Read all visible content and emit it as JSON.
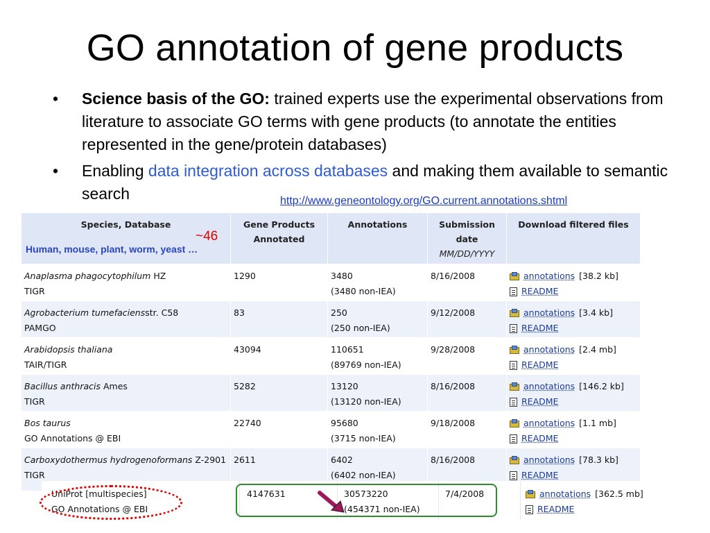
{
  "slide": {
    "title": "GO annotation of gene products",
    "bullets": [
      {
        "bold": "Science basis of the GO:",
        "text": " trained experts use the experimental observations from literature to associate GO terms with gene products (to annotate the entities represented in the gene/protein databases)"
      },
      {
        "prefix": "Enabling ",
        "highlight": "data integration across databases",
        "suffix": " and making them available to semantic search"
      }
    ],
    "bullet_char": "•",
    "source_url": "http://www.geneontology.org/GO.current.annotations.shtml",
    "species_count_note": "~46",
    "species_examples_note": "Human, mouse, plant, worm, yeast …"
  },
  "table": {
    "headers": {
      "species": "Species, Database",
      "gene_products": "Gene Products Annotated",
      "annotations": "Annotations",
      "submission": "Submission date",
      "submission_format": "MM/DD/YYYY",
      "download": "Download filtered files"
    },
    "rows": [
      {
        "species": "Anaplasma phagocytophilum",
        "strain": " HZ",
        "database": "TIGR",
        "gene_products": "1290",
        "annotations": "3480",
        "non_iea": "(3480 non-IEA)",
        "date": "8/16/2008",
        "file_label": "annotations",
        "file_size": "[38.2 kb]",
        "readme": "README"
      },
      {
        "species": "Agrobacterium tumefaciens",
        "strain": "str. C58",
        "database": "PAMGO",
        "gene_products": "83",
        "annotations": "250",
        "non_iea": "(250 non-IEA)",
        "date": "9/12/2008",
        "file_label": "annotations",
        "file_size": "[3.4 kb]",
        "readme": "README"
      },
      {
        "species": "Arabidopsis thaliana",
        "strain": "",
        "database": "TAIR/TIGR",
        "gene_products": "43094",
        "annotations": "110651",
        "non_iea": "(89769 non-IEA)",
        "date": "9/28/2008",
        "file_label": "annotations",
        "file_size": "[2.4 mb]",
        "readme": "README"
      },
      {
        "species": "Bacillus anthracis",
        "strain": " Ames",
        "database": "TIGR",
        "gene_products": "5282",
        "annotations": "13120",
        "non_iea": "(13120 non-IEA)",
        "date": "8/16/2008",
        "file_label": "annotations",
        "file_size": "[146.2 kb]",
        "readme": "README"
      },
      {
        "species": "Bos taurus",
        "strain": "",
        "database": "GO Annotations @ EBI",
        "gene_products": "22740",
        "annotations": "95680",
        "non_iea": "(3715 non-IEA)",
        "date": "9/18/2008",
        "file_label": "annotations",
        "file_size": "[1.1 mb]",
        "readme": "README"
      },
      {
        "species": "Carboxydothermus hydrogenoformans",
        "strain": " Z-2901",
        "database": "TIGR",
        "gene_products": "2611",
        "annotations": "6402",
        "non_iea": "(6402 non-IEA)",
        "date": "8/16/2008",
        "file_label": "annotations",
        "file_size": "[78.3 kb]",
        "readme": "README"
      }
    ],
    "uniprot_row": {
      "species": "UniProt [multispecies]",
      "database": "GO Annotations @ EBI",
      "gene_products": "4147631",
      "annotations": "30573220",
      "non_iea": "(454371 non-IEA)",
      "date": "7/4/2008",
      "file_label": "annotations",
      "file_size": "[362.5 mb]",
      "readme": "README"
    }
  },
  "colors": {
    "header_bg": "#dfe6f5",
    "stripe_bg": "#edf1fa",
    "highlight_text": "#2e5bd4",
    "note_red": "#e00000",
    "box_green": "#2e8b2e",
    "arrow": "#9b1a5a"
  }
}
